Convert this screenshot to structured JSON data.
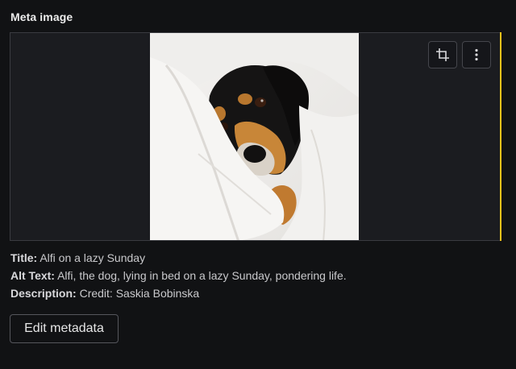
{
  "field": {
    "label": "Meta image"
  },
  "image": {
    "description": "dog-photo",
    "toolbar": {
      "crop_icon": "crop-icon",
      "more_icon": "more-vertical-icon"
    },
    "focus_color": "#f1c21b"
  },
  "metadata": {
    "title_label": "Title:",
    "title_value": "Alfi on a lazy Sunday",
    "alt_label": "Alt Text:",
    "alt_value": "Alfi, the dog, lying in bed on a lazy Sunday, pondering life.",
    "description_label": "Description:",
    "description_value": "Credit: Saskia Bobinska"
  },
  "actions": {
    "edit_label": "Edit metadata"
  }
}
